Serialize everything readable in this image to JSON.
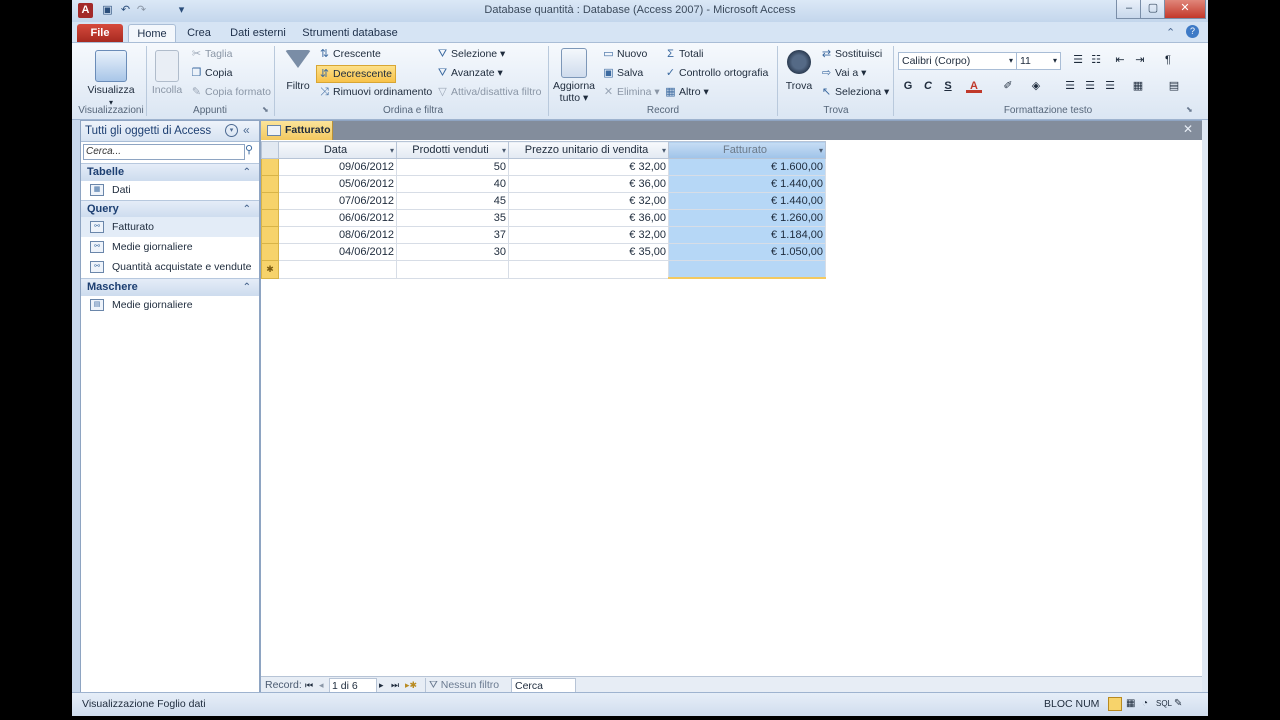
{
  "window": {
    "title": "Database quantità : Database (Access 2007)  -  Microsoft Access",
    "controls": [
      "–",
      "▢",
      "✕"
    ]
  },
  "tabs": [
    "File",
    "Home",
    "Crea",
    "Dati esterni",
    "Strumenti database"
  ],
  "ribbon": {
    "views": {
      "button": "Visualizza",
      "group": "Visualizzazioni"
    },
    "clipboard": {
      "paste": "Incolla",
      "cut": "Taglia",
      "copy": "Copia",
      "format_painter": "Copia formato",
      "group": "Appunti"
    },
    "sort_filter": {
      "filter": "Filtro",
      "ascending": "Crescente",
      "descending": "Decrescente",
      "remove_sort": "Rimuovi ordinamento",
      "selection": "Selezione",
      "advanced": "Avanzate",
      "toggle_filter": "Attiva/disattiva filtro",
      "group": "Ordina e filtra"
    },
    "records": {
      "refresh": "Aggiorna tutto",
      "new": "Nuovo",
      "save": "Salva",
      "delete": "Elimina",
      "totals": "Totali",
      "spelling": "Controllo ortografia",
      "more": "Altro",
      "group": "Record"
    },
    "find": {
      "find": "Trova",
      "replace": "Sostituisci",
      "goto": "Vai a",
      "select": "Seleziona",
      "group": "Trova"
    },
    "text_format": {
      "font": "Calibri (Corpo)",
      "size": "11",
      "bold": "G",
      "italic": "C",
      "underline": "S",
      "group": "Formattazione testo"
    }
  },
  "nav": {
    "header": "Tutti gli oggetti di Access",
    "search_placeholder": "Cerca...",
    "groups": [
      {
        "name": "Tabelle",
        "items": [
          "Dati"
        ]
      },
      {
        "name": "Query",
        "items": [
          "Fatturato",
          "Medie giornaliere",
          "Quantità acquistate e vendute"
        ]
      },
      {
        "name": "Maschere",
        "items": [
          "Medie giornaliere"
        ]
      }
    ]
  },
  "document": {
    "tab": "Fatturato",
    "columns": [
      "Data",
      "Prodotti venduti",
      "Prezzo unitario di vendita",
      "Fatturato"
    ],
    "rows": [
      [
        "09/06/2012",
        "50",
        "€ 32,00",
        "€ 1.600,00"
      ],
      [
        "05/06/2012",
        "40",
        "€ 36,00",
        "€ 1.440,00"
      ],
      [
        "07/06/2012",
        "45",
        "€ 32,00",
        "€ 1.440,00"
      ],
      [
        "06/06/2012",
        "35",
        "€ 36,00",
        "€ 1.260,00"
      ],
      [
        "08/06/2012",
        "37",
        "€ 32,00",
        "€ 1.184,00"
      ],
      [
        "04/06/2012",
        "30",
        "€ 35,00",
        "€ 1.050,00"
      ]
    ],
    "new_row_marker": "✱"
  },
  "record_nav": {
    "label": "Record:",
    "position": "1 di 6",
    "filter": "Nessun filtro",
    "search": "Cerca"
  },
  "status": {
    "left": "Visualizzazione Foglio dati",
    "right": "BLOC NUM"
  },
  "colors": {
    "accent": "#f7d36b",
    "selected_column": "#b6d7f6",
    "file_tab": "#c0392b"
  }
}
